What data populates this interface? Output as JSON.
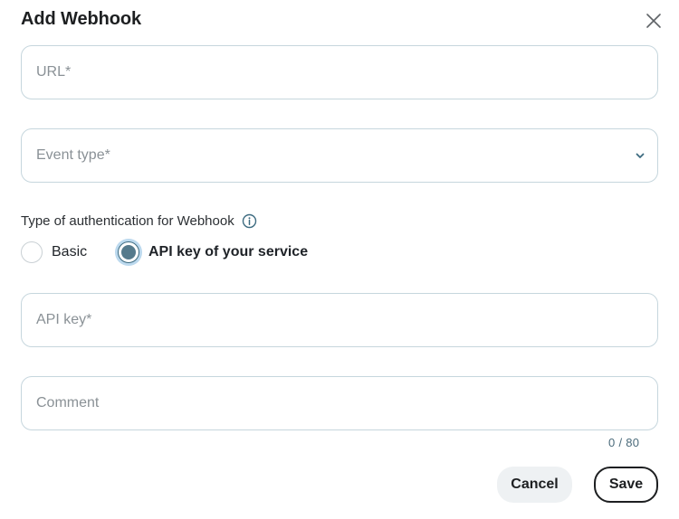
{
  "dialog": {
    "title": "Add Webhook",
    "close_icon": "close-icon"
  },
  "fields": {
    "url_placeholder": "URL*",
    "event_type_placeholder": "Event type*",
    "api_key_placeholder": "API key*",
    "comment_placeholder": "Comment",
    "comment_counter": "0 / 80"
  },
  "auth": {
    "label": "Type of authentication for Webhook",
    "info_icon": "info-icon",
    "options": [
      {
        "label": "Basic",
        "checked": false
      },
      {
        "label": "API key of your service",
        "checked": true
      }
    ]
  },
  "actions": {
    "cancel_label": "Cancel",
    "save_label": "Save"
  },
  "colors": {
    "border": "#c6d6dd",
    "radio_selected": "#557a8c",
    "radio_ring": "#bcd9ee",
    "counter": "#4a6a7a"
  }
}
